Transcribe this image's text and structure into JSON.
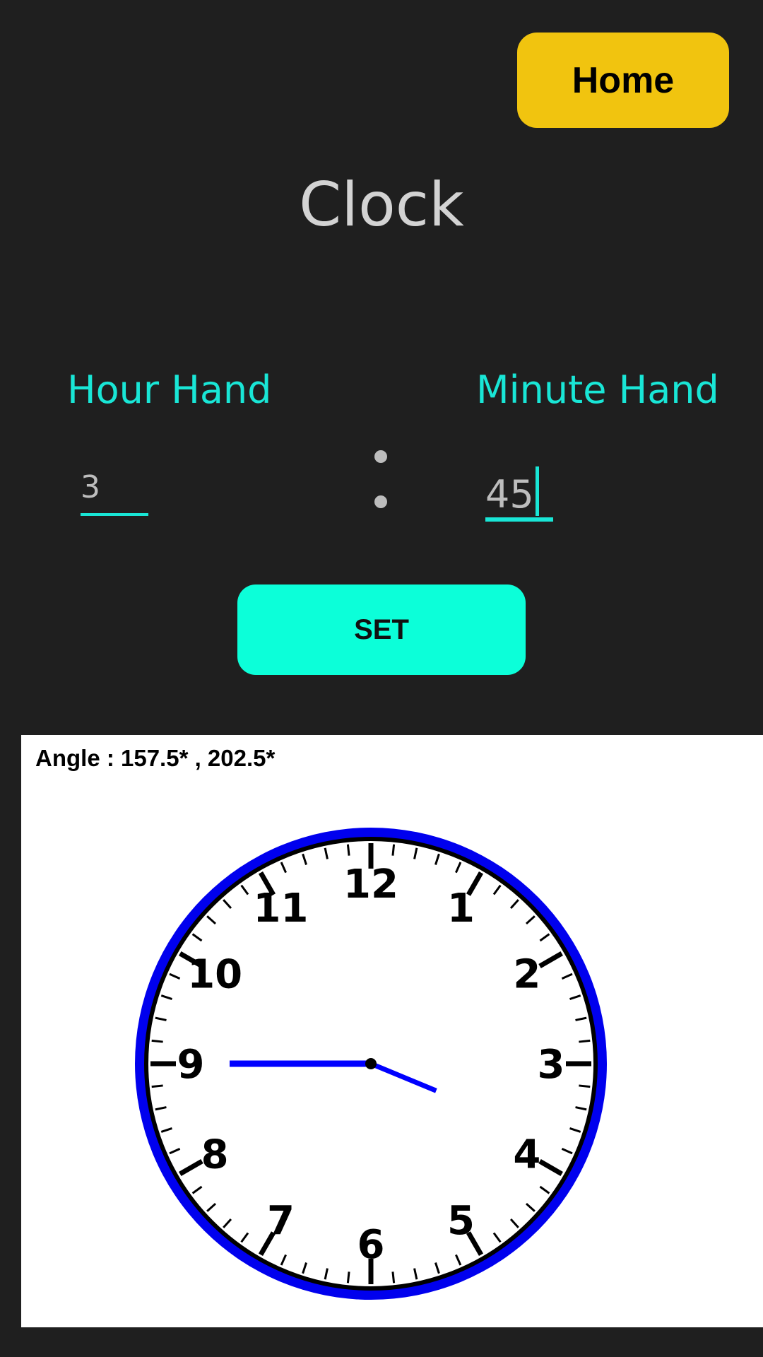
{
  "header": {
    "home_label": "Home",
    "title": "Clock"
  },
  "inputs": {
    "hour_label": "Hour Hand",
    "minute_label": "Minute Hand",
    "hour_value": "3",
    "minute_value": "45"
  },
  "actions": {
    "set_label": "SET"
  },
  "clock": {
    "angle_text": "Angle : 157.5* , 202.5*",
    "numerals": [
      "12",
      "1",
      "2",
      "3",
      "4",
      "5",
      "6",
      "7",
      "8",
      "9",
      "10",
      "11"
    ],
    "hour": 3,
    "minute": 45,
    "hand_color": "#0000ff",
    "rim_color": "#0000ee"
  },
  "colors": {
    "background": "#1f1f1f",
    "accent": "#19e6d6",
    "home_button": "#f1c40f",
    "set_button": "#0cffd9"
  }
}
